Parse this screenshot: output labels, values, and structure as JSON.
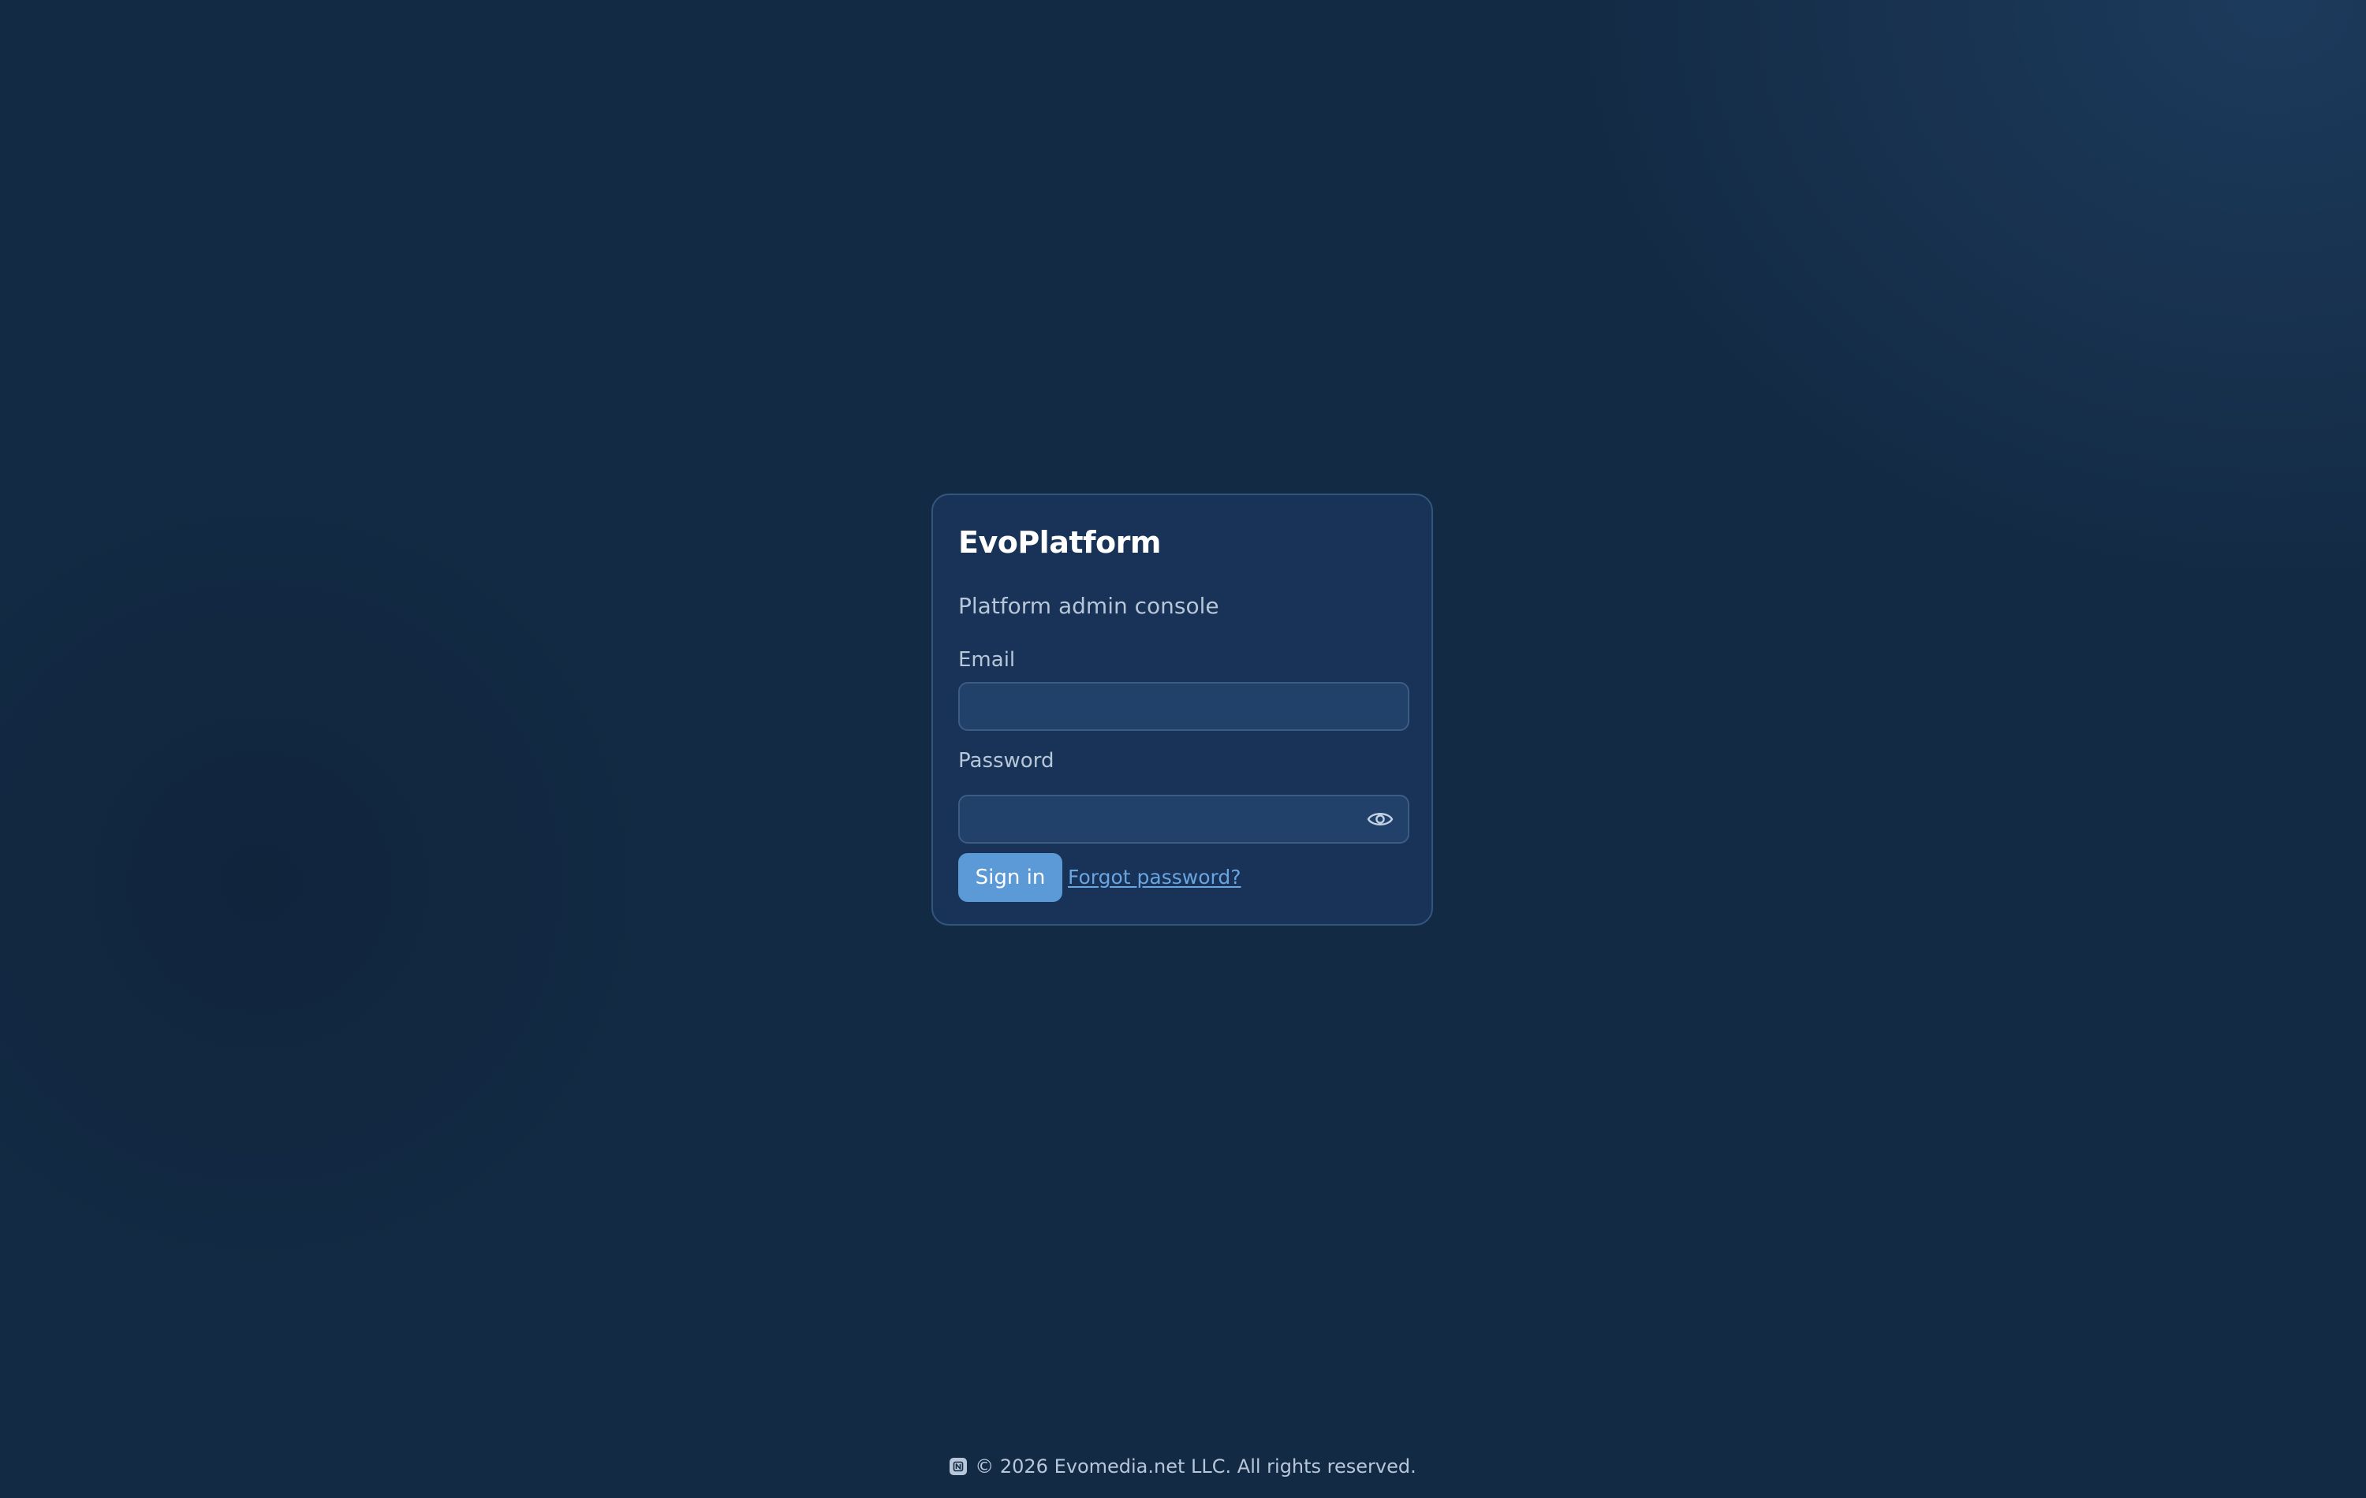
{
  "app": {
    "title": "EvoPlatform",
    "subtitle": "Platform admin console"
  },
  "form": {
    "email_label": "Email",
    "email_value": "",
    "password_label": "Password",
    "password_value": "",
    "signin_label": "Sign in",
    "forgot_label": "Forgot password?"
  },
  "footer": {
    "text": "© 2026 Evomedia.net LLC. All rights reserved.",
    "logo_icon": "brand-logo-icon"
  },
  "icons": {
    "password_toggle": "eye-icon"
  },
  "colors": {
    "background": "#132a44",
    "card": "#183357",
    "accent": "#5b9ad6",
    "link": "#6aa5e0",
    "text_muted": "#b7c6d8"
  }
}
